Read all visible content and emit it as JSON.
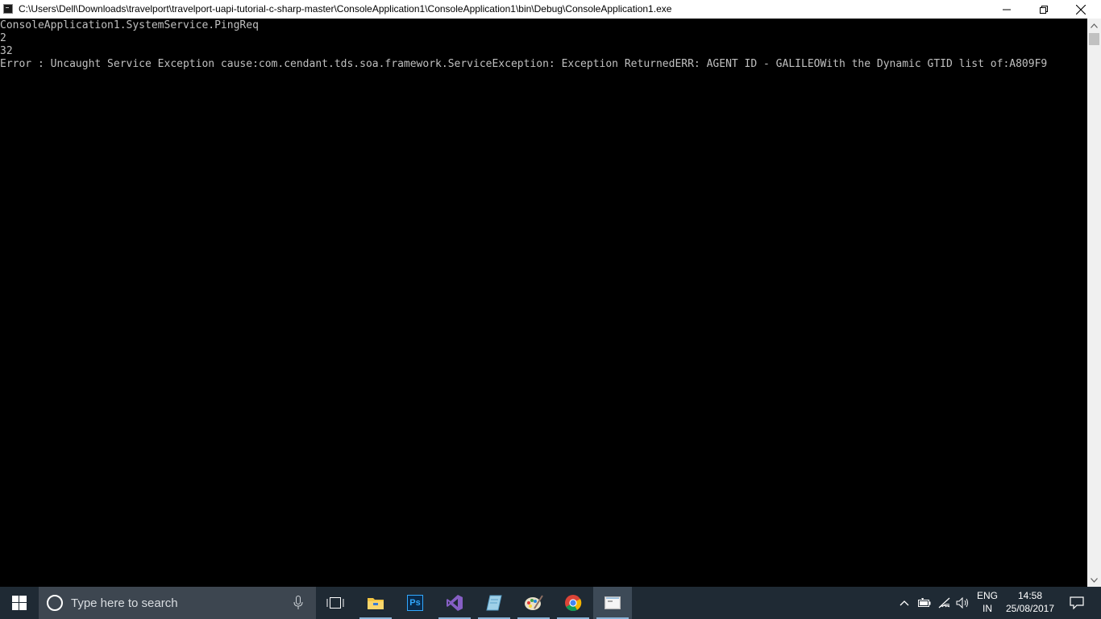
{
  "window": {
    "title": "C:\\Users\\Dell\\Downloads\\travelport\\travelport-uapi-tutorial-c-sharp-master\\ConsoleApplication1\\ConsoleApplication1\\bin\\Debug\\ConsoleApplication1.exe",
    "controls": [
      "minimize-icon",
      "restore-icon",
      "close-icon"
    ]
  },
  "console": {
    "lines": [
      "ConsoleApplication1.SystemService.PingReq",
      "2",
      "32",
      "Error : Uncaught Service Exception cause:com.cendant.tds.soa.framework.ServiceException: Exception ReturnedERR: AGENT ID - GALILEOWith the Dynamic GTID list of:A809F9"
    ],
    "text_color": "#c0c0c0",
    "background": "#000000"
  },
  "taskbar": {
    "search_placeholder": "Type here to search",
    "apps": [
      "task-view-icon",
      "file-explorer-icon",
      "photoshop-icon",
      "visual-studio-icon",
      "notepad-icon",
      "paint-icon",
      "chrome-icon",
      "console-app-icon"
    ],
    "photoshop_label": "Ps",
    "tray": {
      "language_line1": "ENG",
      "language_line2": "IN",
      "time": "14:58",
      "date": "25/08/2017"
    },
    "background": "#1f2a34"
  }
}
